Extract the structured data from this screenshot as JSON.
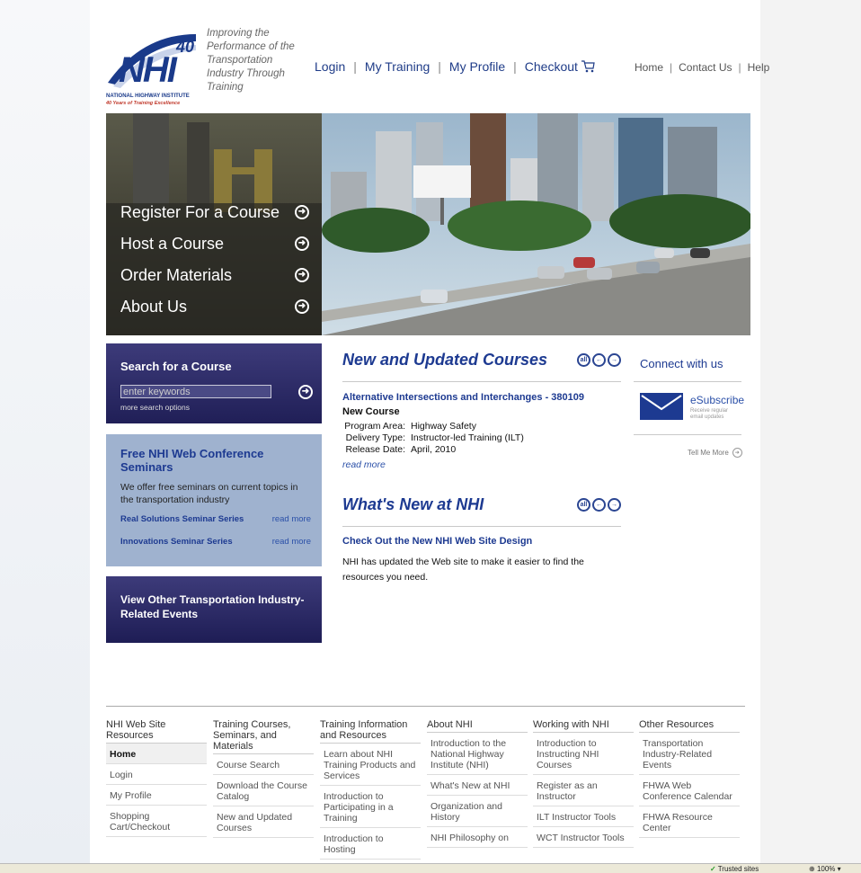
{
  "logo": {
    "number": "40",
    "acronym": "NHI",
    "org_name": "NATIONAL HIGHWAY INSTITUTE",
    "tagline": "40 Years of Training Excellence"
  },
  "tagline": "Improving the Performance of the Transportation Industry Through Training",
  "topnav": [
    "Login",
    "My Training",
    "My Profile",
    "Checkout"
  ],
  "utilnav": [
    "Home",
    "Contact Us",
    "Help"
  ],
  "hero_menu": [
    "Register For a Course",
    "Host a Course",
    "Order Materials",
    "About Us"
  ],
  "search": {
    "title": "Search for a Course",
    "input_value": "enter keywords",
    "more": "more search options"
  },
  "seminars": {
    "title": "Free NHI Web Conference Seminars",
    "desc": "We offer free seminars on current topics in the transportation industry",
    "series": [
      {
        "name": "Real Solutions Seminar Series",
        "link": "read more"
      },
      {
        "name": "Innovations Seminar Series",
        "link": "read more"
      }
    ]
  },
  "events": "View Other Transportation Industry-Related Events",
  "new_courses": {
    "title": "New and Updated Courses",
    "pager": [
      "all",
      "←",
      "→"
    ],
    "course_title": "Alternative Intersections and Interchanges - 380109",
    "course_sub": "New Course",
    "meta": [
      {
        "k": "Program Area:",
        "v": "Highway Safety"
      },
      {
        "k": "Delivery Type:",
        "v": "Instructor-led Training (ILT)"
      },
      {
        "k": "Release Date:",
        "v": "April, 2010"
      }
    ],
    "read_more": "read more"
  },
  "whats_new": {
    "title": "What's New at NHI",
    "pager": [
      "all",
      "←",
      "→"
    ],
    "news_title": "Check Out the New NHI Web Site Design",
    "news_body": "NHI has updated the Web site to make it easier to find the resources you need."
  },
  "connect": {
    "title": "Connect with us",
    "esubscribe": "eSubscribe",
    "esub_small": "Receive regular email updates",
    "tell_more": "Tell Me More"
  },
  "footer": [
    {
      "head": "NHI Web Site Resources",
      "items": [
        "Home",
        "Login",
        "My Profile",
        "Shopping Cart/Checkout"
      ]
    },
    {
      "head": "Training Courses, Seminars, and Materials",
      "items": [
        "Course Search",
        "Download the Course Catalog",
        "New and Updated Courses"
      ]
    },
    {
      "head": "Training Information and Resources",
      "items": [
        "Learn about NHI Training Products and Services",
        "Introduction to Participating in a Training",
        "Introduction to Hosting"
      ]
    },
    {
      "head": "About NHI",
      "items": [
        "Introduction to the National Highway Institute (NHI)",
        "What's New at NHI",
        "Organization and History",
        "NHI Philosophy on"
      ]
    },
    {
      "head": "Working with NHI",
      "items": [
        "Introduction to Instructing NHI Courses",
        "Register as an Instructor",
        "ILT Instructor Tools",
        "WCT Instructor Tools"
      ]
    },
    {
      "head": "Other Resources",
      "items": [
        "Transportation Industry-Related Events",
        "FHWA Web Conference Calendar",
        "FHWA Resource Center"
      ]
    }
  ],
  "status": {
    "trusted": "Trusted sites",
    "zoom": "100%"
  }
}
